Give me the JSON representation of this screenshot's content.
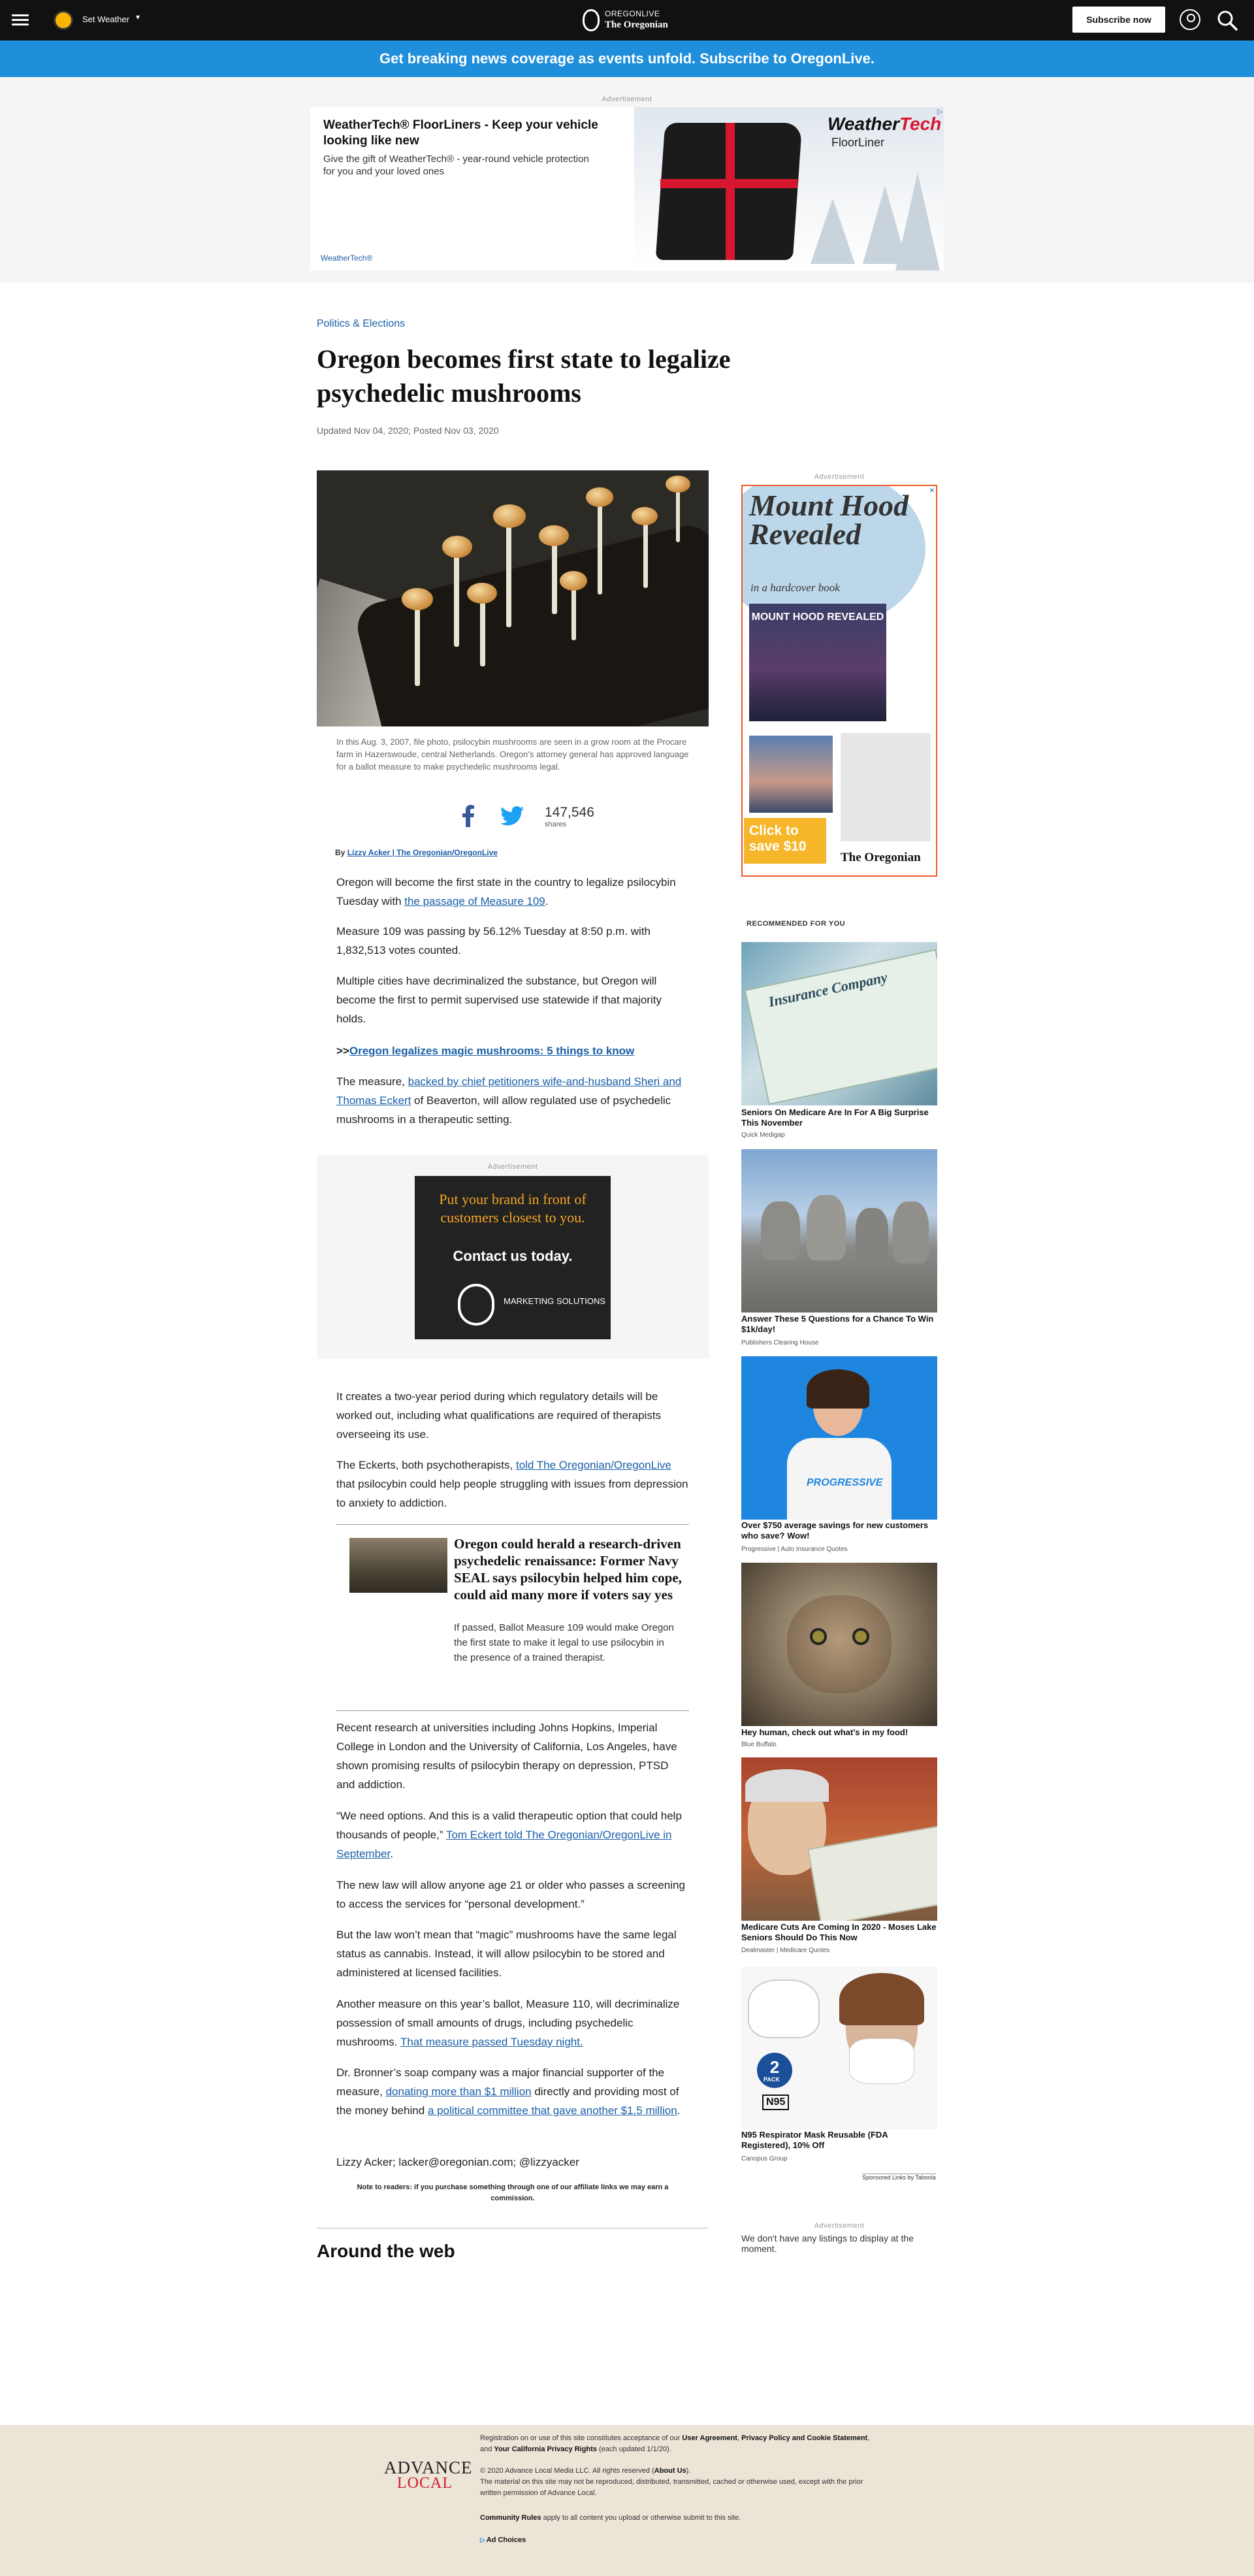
{
  "topnav": {
    "weather_label": "Set Weather",
    "logo_top": "OREGONLIVE",
    "logo_bottom": "The Oregonian",
    "subscribe_label": "Subscribe now"
  },
  "promo_bar": {
    "text": "Get breaking news coverage as events unfold. Subscribe to OregonLive."
  },
  "top_ad": {
    "label": "Advertisement",
    "headline": "WeatherTech® FloorLiners - Keep your vehicle looking like new",
    "body": "Give the gift of WeatherTech® - year-round vehicle protection for you and your loved ones",
    "brand": "WeatherTech®",
    "logo_a": "Weather",
    "logo_b": "Tech",
    "logo_sub": "FloorLiner"
  },
  "article": {
    "category": "Politics & Elections",
    "headline": "Oregon becomes first state to legalize psychedelic mushrooms",
    "dateline": "Updated Nov 04, 2020; Posted Nov 03, 2020",
    "caption": "In this Aug. 3, 2007, file photo, psilocybin mushrooms are seen in a grow room at the Procare farm in Hazerswoude, central Netherlands. Oregon's attorney general has approved language for a ballot measure to make psychedelic mushrooms legal.",
    "share_count": "147,546",
    "share_label": "shares",
    "byline_prefix": "By",
    "byline_author": "Lizzy Acker | The Oregonian/OregonLive",
    "p1_text": "Oregon will become the first state in the country to legalize psilocybin Tuesday with ",
    "p1_link": "the passage of Measure 109",
    "p1_end": ".",
    "p2": "Measure 109 was passing by 56.12% Tuesday at 8:50 p.m. with 1,832,513 votes counted.",
    "p3": "Multiple cities have decriminalized the substance, but Oregon will become the first to permit supervised use statewide if that majority holds.",
    "p4_prefix": ">>",
    "p4_link": "Oregon legalizes magic mushrooms: 5 things to know",
    "p5_a": "The measure, ",
    "p5_link": "backed by chief petitioners wife-and-husband Sheri and Thomas Eckert",
    "p5_b": " of Beaverton, will allow regulated use of psychedelic mushrooms in a therapeutic setting.",
    "p6": "It creates a two-year period during which regulatory details will be worked out, including what qualifications are required of therapists overseeing its use.",
    "p7_a": "The Eckerts, both psychotherapists, ",
    "p7_link": "told The Oregonian/OregonLive",
    "p7_b": " that psilocybin could help people struggling with issues from depression to anxiety to addiction.",
    "related_title": "Oregon could herald a research-driven psychedelic renaissance: Former Navy SEAL says psilocybin helped him cope, could aid many more if voters say yes",
    "related_desc": "If passed, Ballot Measure 109 would make Oregon the first state to make it legal to use psilocybin in the presence of a trained therapist.",
    "p8": "Recent research at universities including Johns Hopkins, Imperial College in London and the University of California, Los Angeles, have shown promising results of psilocybin therapy on depression, PTSD and addiction.",
    "p9_a": "“We need options. And this is a valid therapeutic option that could help thousands of people,” ",
    "p9_link": "Tom Eckert told The Oregonian/OregonLive in September",
    "p9_b": ".",
    "p10": "The new law will allow anyone age 21 or older who passes a screening to access the services for “personal development.”",
    "p11": "But the law won’t mean that “magic” mushrooms have the same legal status as cannabis. Instead, it will allow psilocybin to be stored and administered at licensed facilities.",
    "p12_a": "Another measure on this year’s ballot, Measure 110, will decriminalize possession of small amounts of drugs, including psychedelic mushrooms. ",
    "p12_link": "That measure passed Tuesday night.",
    "p13_a": "Dr. Bronner’s soap company was a major financial supporter of the measure, ",
    "p13_link1": "donating more than $1 million",
    "p13_b": " directly and providing most of the money behind ",
    "p13_link2": "a political committee that gave another $1.5 million",
    "p13_c": ".",
    "p14": "Lizzy Acker; lacker@oregonian.com; @lizzyacker",
    "note": "Note to readers: if you purchase something through one of our affiliate links we may earn a commission.",
    "around": "Around the web"
  },
  "inline_ad": {
    "label": "Advertisement",
    "line1": "Put your brand in front of customers closest to you.",
    "line2": "Contact us today.",
    "logo_text": "MARKETING SOLUTIONS"
  },
  "side_ad": {
    "label": "Advertisement",
    "title": "Mount Hood Revealed",
    "subtitle": "in a hardcover book",
    "book_title": "MOUNT HOOD REVEALED",
    "cta": "Click to save $10",
    "logo": "The Oregonian"
  },
  "recommended": {
    "heading": "RECOMMENDED FOR YOU",
    "items": [
      {
        "title": "Seniors On Medicare Are In For A Big Surprise This November",
        "source": "Quick Medigap"
      },
      {
        "title": "Answer These 5 Questions for a Chance To Win $1k/day!",
        "source": "Publishers Clearing House"
      },
      {
        "title": "Over $750 average savings for new customers who save? Wow!",
        "source": "Progressive | Auto Insurance Quotes"
      },
      {
        "title": "Hey human, check out what's in my food!",
        "source": "Blue Buffalo"
      },
      {
        "title": "Medicare Cuts Are Coming In 2020 - Moses Lake Seniors Should Do This Now",
        "source": "Dealmaster | Medicare Quotes"
      },
      {
        "title": "N95 Respirator Mask Reusable (FDA Registered), 10% Off",
        "source": "Canopus Group"
      }
    ],
    "taboola": "Sponsored Links by Taboola",
    "card1_text": "Insurance Company",
    "card3_text": "PROGRESSIVE",
    "card6_badge_num": "2",
    "card6_badge_text": "PACK",
    "card6_n95": "N95"
  },
  "side_ad2": {
    "label": "Advertisement",
    "empty_text": "We don't have any listings to display at the moment."
  },
  "footer": {
    "logo_a": "ADVANCE",
    "logo_b": "LOCAL",
    "line1_a": "Registration on or use of this site constitutes acceptance of our ",
    "line1_b": "User Agreement",
    "line1_c": ", ",
    "line1_d": "Privacy Policy and Cookie Statement",
    "line1_e": ", and ",
    "line1_f": "Your California Privacy Rights",
    "line1_g": " (each updated 1/1/20).",
    "copyright_a": "© 2020 Advance Local Media LLC. All rights reserved (",
    "copyright_b": "About Us",
    "copyright_c": ").",
    "copyright_rest": "The material on this site may not be reproduced, distributed, transmitted, cached or otherwise used, except with the prior written permission of Advance Local.",
    "community_a": "Community Rules",
    "community_b": " apply to all content you upload or otherwise submit to this site.",
    "ad_choices": "Ad Choices"
  }
}
